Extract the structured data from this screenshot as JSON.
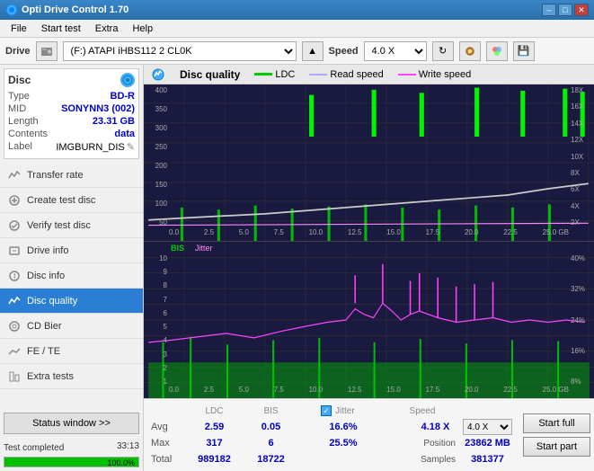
{
  "titleBar": {
    "title": "Opti Drive Control 1.70",
    "minimizeBtn": "–",
    "maximizeBtn": "□",
    "closeBtn": "✕"
  },
  "menuBar": {
    "items": [
      "File",
      "Start test",
      "Extra",
      "Help"
    ]
  },
  "driveBar": {
    "label": "Drive",
    "driveValue": "(F:)  ATAPI iHBS112  2 CL0K",
    "speedLabel": "Speed",
    "speedValue": "4.0 X"
  },
  "disc": {
    "label": "Disc",
    "typeKey": "Type",
    "typeVal": "BD-R",
    "midKey": "MID",
    "midVal": "SONYNN3 (002)",
    "lengthKey": "Length",
    "lengthVal": "23.31 GB",
    "contentsKey": "Contents",
    "contentsVal": "data",
    "labelKey": "Label",
    "labelVal": "IMGBURN_DIS"
  },
  "sidebarItems": [
    {
      "id": "transfer-rate",
      "label": "Transfer rate",
      "active": false
    },
    {
      "id": "create-test-disc",
      "label": "Create test disc",
      "active": false
    },
    {
      "id": "verify-test-disc",
      "label": "Verify test disc",
      "active": false
    },
    {
      "id": "drive-info",
      "label": "Drive info",
      "active": false
    },
    {
      "id": "disc-info",
      "label": "Disc info",
      "active": false
    },
    {
      "id": "disc-quality",
      "label": "Disc quality",
      "active": true
    },
    {
      "id": "cd-bier",
      "label": "CD Bier",
      "active": false
    },
    {
      "id": "fe-te",
      "label": "FE / TE",
      "active": false
    },
    {
      "id": "extra-tests",
      "label": "Extra tests",
      "active": false
    }
  ],
  "statusBtn": "Status window >>",
  "progressBar": {
    "percent": 100,
    "statusText": "Test completed",
    "timeText": "33:13"
  },
  "discQuality": {
    "title": "Disc quality",
    "legendLDC": "LDC",
    "legendRead": "Read speed",
    "legendWrite": "Write speed",
    "legendBIS": "BIS",
    "legendJitter": "Jitter",
    "upperChart": {
      "yLabels": [
        "400",
        "350",
        "300",
        "250",
        "200",
        "150",
        "100",
        "50"
      ],
      "yLabelsRight": [
        "18X",
        "16X",
        "14X",
        "12X",
        "10X",
        "8X",
        "6X",
        "4X",
        "2X"
      ],
      "xLabels": [
        "0.0",
        "2.5",
        "5.0",
        "7.5",
        "10.0",
        "12.5",
        "15.0",
        "17.5",
        "20.0",
        "22.5",
        "25.0 GB"
      ]
    },
    "lowerChart": {
      "yLabels": [
        "10",
        "9",
        "8",
        "7",
        "6",
        "5",
        "4",
        "3",
        "2",
        "1"
      ],
      "yLabelsRight": [
        "40%",
        "32%",
        "24%",
        "16%",
        "8%"
      ],
      "xLabels": [
        "0.0",
        "2.5",
        "5.0",
        "7.5",
        "10.0",
        "12.5",
        "15.0",
        "17.5",
        "20.0",
        "22.5",
        "25.0 GB"
      ]
    }
  },
  "statsTable": {
    "colHeaders": [
      "",
      "LDC",
      "BIS",
      "",
      "Jitter",
      "Speed",
      ""
    ],
    "rows": [
      {
        "label": "Avg",
        "ldc": "2.59",
        "bis": "0.05",
        "jitter": "16.6%",
        "speed": "4.18 X",
        "speedSel": "4.0 X"
      },
      {
        "label": "Max",
        "ldc": "317",
        "bis": "6",
        "jitter": "25.5%",
        "position": "23862 MB"
      },
      {
        "label": "Total",
        "ldc": "989182",
        "bis": "18722",
        "jitter": "",
        "samples": "381377"
      }
    ],
    "jitterChecked": true,
    "speedLabel": "Speed",
    "positionLabel": "Position",
    "samplesLabel": "Samples",
    "btnStartFull": "Start full",
    "btnStartPart": "Start part"
  }
}
